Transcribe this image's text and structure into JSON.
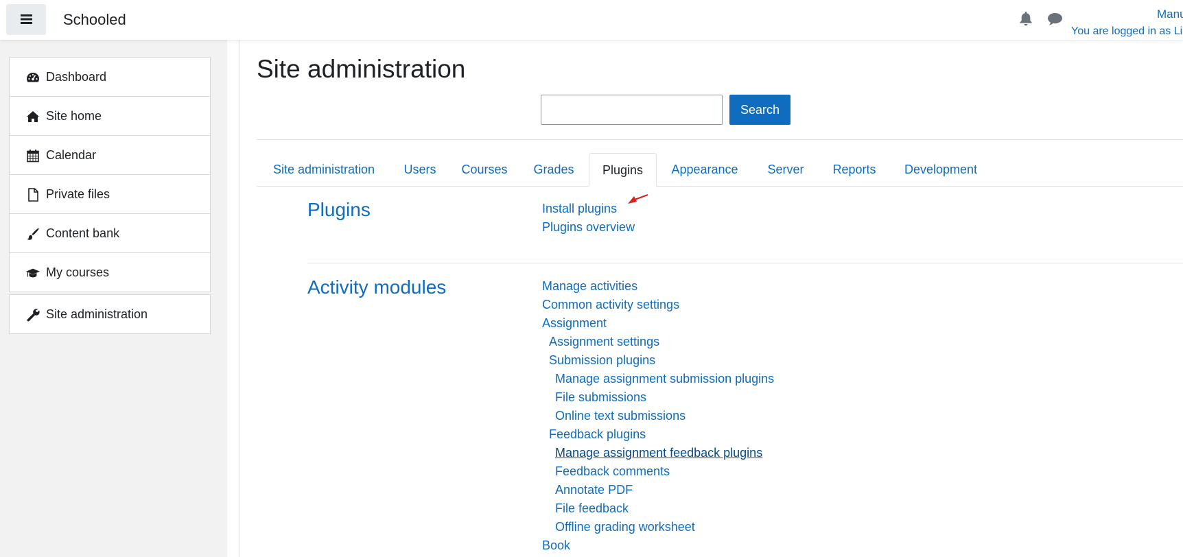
{
  "navbar": {
    "site_name": "Schooled",
    "user_name": "Manu",
    "login_status": "You are logged in as Li"
  },
  "drawer": {
    "items": [
      {
        "label": "Dashboard",
        "icon": "tachometer-icon"
      },
      {
        "label": "Site home",
        "icon": "home-icon"
      },
      {
        "label": "Calendar",
        "icon": "calendar-icon"
      },
      {
        "label": "Private files",
        "icon": "file-icon"
      },
      {
        "label": "Content bank",
        "icon": "paintbrush-icon"
      },
      {
        "label": "My courses",
        "icon": "graduation-cap-icon"
      }
    ],
    "admin_item": {
      "label": "Site administration",
      "icon": "wrench-icon"
    }
  },
  "main": {
    "title": "Site administration",
    "search": {
      "value": "",
      "button_label": "Search"
    },
    "tabs": [
      {
        "label": "Site administration"
      },
      {
        "label": "Users"
      },
      {
        "label": "Courses"
      },
      {
        "label": "Grades"
      },
      {
        "label": "Plugins",
        "active": true
      },
      {
        "label": "Appearance"
      },
      {
        "label": "Server"
      },
      {
        "label": "Reports"
      },
      {
        "label": "Development"
      }
    ],
    "plugins_section": {
      "title": "Plugins",
      "links": [
        "Install plugins",
        "Plugins overview"
      ]
    },
    "activity_section": {
      "title": "Activity modules",
      "links": [
        "Manage activities",
        "Common activity settings",
        "Assignment",
        "Assignment settings",
        "Submission plugins",
        "Manage assignment submission plugins",
        "File submissions",
        "Online text submissions",
        "Feedback plugins",
        "Manage assignment feedback plugins",
        "Feedback comments",
        "Annotate PDF",
        "File feedback",
        "Offline grading worksheet",
        "Book"
      ]
    }
  },
  "colors": {
    "link": "#0f6cbf",
    "arrow": "#e02020",
    "drawer_bg": "#f2f2f2"
  }
}
